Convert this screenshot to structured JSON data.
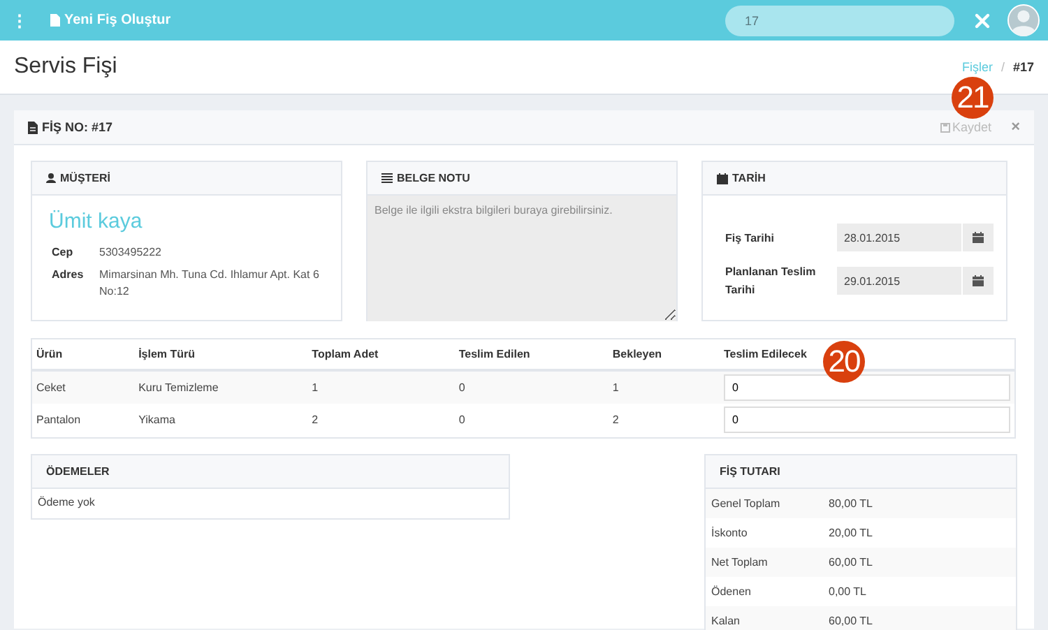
{
  "topbar": {
    "menu_icon": "⋮",
    "title": "Yeni Fiş Oluştur",
    "search_value": "17"
  },
  "header": {
    "title": "Servis Fişi",
    "breadcrumb_separator": "/",
    "breadcrumb": [
      {
        "label": "Fişler",
        "link": true
      },
      {
        "label": "#17",
        "link": false
      }
    ]
  },
  "panel": {
    "title": "FİŞ NO: #17",
    "save": "Kaydet",
    "close": "×",
    "callout": "21"
  },
  "customer": {
    "heading": "MÜŞTERİ",
    "name": "Ümit kaya",
    "fields": [
      {
        "label": "Cep",
        "value": "5303495222"
      },
      {
        "label": "Adres",
        "value": "Mimarsinan Mh. Tuna Cd. Ihlamur Apt. Kat 6 No:12"
      }
    ]
  },
  "note": {
    "heading": "BELGE NOTU",
    "placeholder": "Belge ile ilgili ekstra bilgileri buraya girebilirsiniz."
  },
  "dates": {
    "heading": "TARİH",
    "fields": [
      {
        "label": "Fiş Tarihi",
        "value": "28.01.2015"
      },
      {
        "label": "Planlanan Teslim Tarihi",
        "value": "29.01.2015"
      }
    ]
  },
  "table": {
    "callout": "20",
    "columns": [
      "Ürün",
      "İşlem Türü",
      "Toplam Adet",
      "Teslim Edilen",
      "Bekleyen",
      "Teslim Edilecek"
    ],
    "rows": [
      {
        "cells": [
          "Ceket",
          "Kuru Temizleme",
          "1",
          "0",
          "1"
        ],
        "input": "0"
      },
      {
        "cells": [
          "Pantalon",
          "Yikama",
          "2",
          "0",
          "2"
        ],
        "input": "0"
      }
    ]
  },
  "payments": {
    "heading": "ÖDEMELER",
    "empty": "Ödeme yok"
  },
  "totals": {
    "heading": "FİŞ TUTARI",
    "rows": [
      {
        "label": "Genel Toplam",
        "value": "80,00 TL"
      },
      {
        "label": "İskonto",
        "value": "20,00 TL"
      },
      {
        "label": "Net Toplam",
        "value": "60,00 TL"
      },
      {
        "label": "Ödenen",
        "value": "0,00 TL"
      },
      {
        "label": "Kalan",
        "value": "60,00 TL"
      }
    ]
  }
}
